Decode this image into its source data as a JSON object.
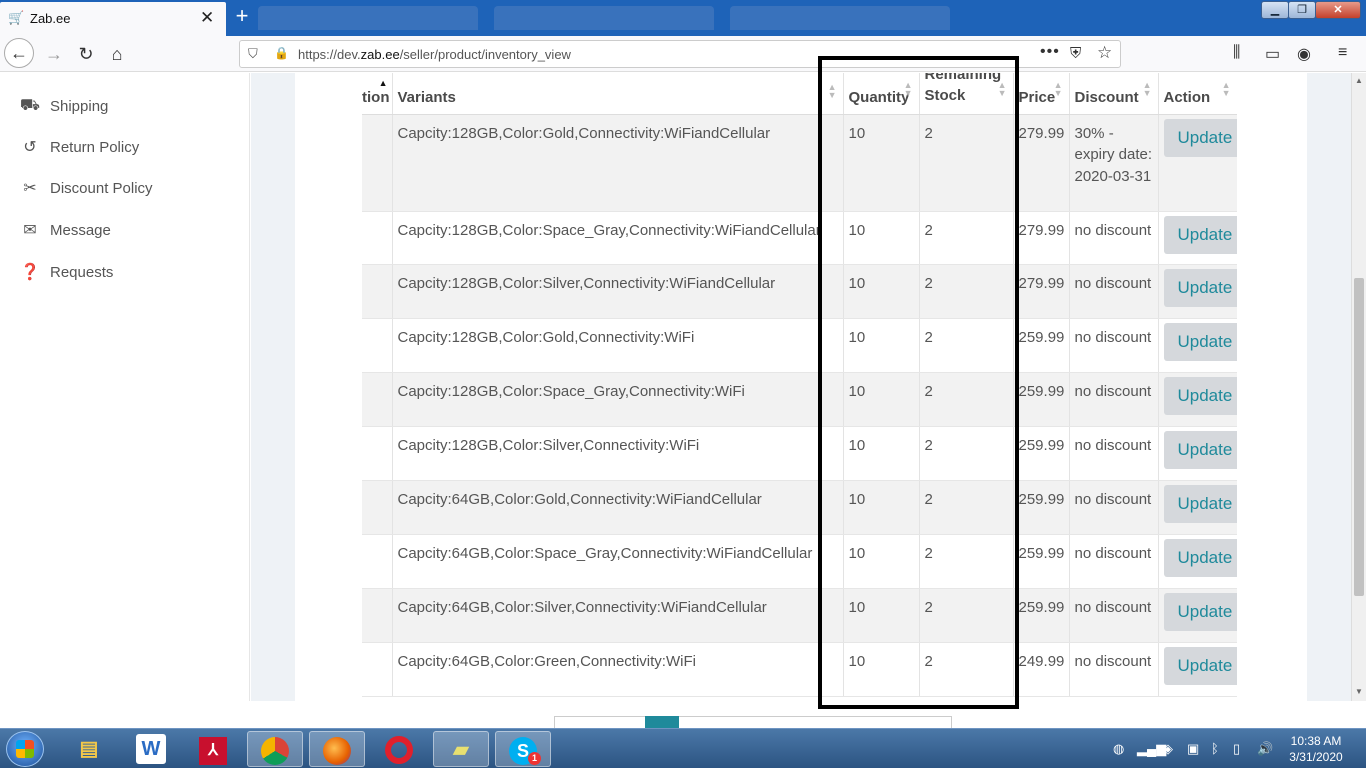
{
  "browser": {
    "tab_title": "Zab.ee",
    "url_prefix": "https://dev.",
    "url_domain": "zab.ee",
    "url_path": "/seller/product/inventory_view"
  },
  "sidebar": {
    "items": [
      {
        "label": "Shipping",
        "icon": "truck-icon"
      },
      {
        "label": "Return Policy",
        "icon": "undo-icon"
      },
      {
        "label": "Discount Policy",
        "icon": "scissors-icon"
      },
      {
        "label": "Message",
        "icon": "envelope-icon"
      },
      {
        "label": "Requests",
        "icon": "question-circle-icon"
      }
    ]
  },
  "table": {
    "headers": {
      "col0": "tion",
      "variants": "Variants",
      "quantity": "Quantity",
      "remaining_top": "Remaining",
      "remaining_bottom": "Stock",
      "price": "Price",
      "discount": "Discount",
      "action": "Action"
    },
    "update_label": "Update",
    "rows": [
      {
        "variant": "Capcity:128GB,Color:Gold,Connectivity:WiFiandCellular",
        "quantity": "10",
        "remaining": "2",
        "price": "279.99",
        "discount": "30% - expiry date: 2020-03-31"
      },
      {
        "variant": "Capcity:128GB,Color:Space_Gray,Connectivity:WiFiandCellular",
        "quantity": "10",
        "remaining": "2",
        "price": "279.99",
        "discount": "no discount"
      },
      {
        "variant": "Capcity:128GB,Color:Silver,Connectivity:WiFiandCellular",
        "quantity": "10",
        "remaining": "2",
        "price": "279.99",
        "discount": "no discount"
      },
      {
        "variant": "Capcity:128GB,Color:Gold,Connectivity:WiFi",
        "quantity": "10",
        "remaining": "2",
        "price": "259.99",
        "discount": "no discount"
      },
      {
        "variant": "Capcity:128GB,Color:Space_Gray,Connectivity:WiFi",
        "quantity": "10",
        "remaining": "2",
        "price": "259.99",
        "discount": "no discount"
      },
      {
        "variant": "Capcity:128GB,Color:Silver,Connectivity:WiFi",
        "quantity": "10",
        "remaining": "2",
        "price": "259.99",
        "discount": "no discount"
      },
      {
        "variant": "Capcity:64GB,Color:Gold,Connectivity:WiFiandCellular",
        "quantity": "10",
        "remaining": "2",
        "price": "259.99",
        "discount": "no discount"
      },
      {
        "variant": "Capcity:64GB,Color:Space_Gray,Connectivity:WiFiandCellular",
        "quantity": "10",
        "remaining": "2",
        "price": "259.99",
        "discount": "no discount"
      },
      {
        "variant": "Capcity:64GB,Color:Silver,Connectivity:WiFiandCellular",
        "quantity": "10",
        "remaining": "2",
        "price": "259.99",
        "discount": "no discount"
      },
      {
        "variant": "Capcity:64GB,Color:Green,Connectivity:WiFi",
        "quantity": "10",
        "remaining": "2",
        "price": "249.99",
        "discount": "no discount"
      }
    ]
  },
  "taskbar": {
    "apps": [
      "file-explorer",
      "word",
      "acrobat",
      "chrome",
      "firefox",
      "opera",
      "sticky-notes",
      "skype"
    ],
    "skype_badge": "1",
    "time": "10:38 AM",
    "date": "3/31/2020"
  },
  "colors": {
    "accent": "#1f8a9b",
    "tabbar": "#1e63b8"
  }
}
